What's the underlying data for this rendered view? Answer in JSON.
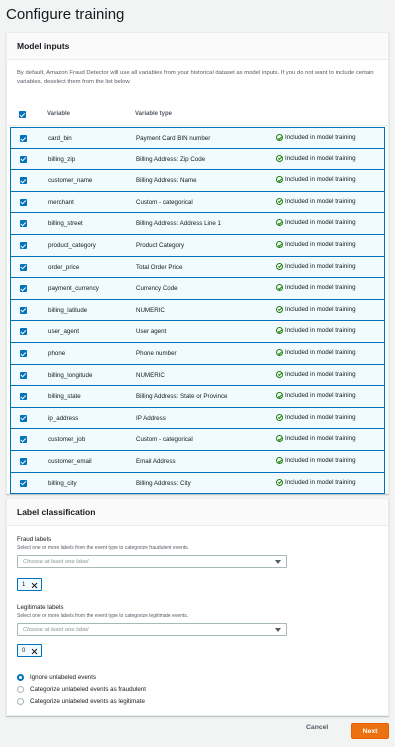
{
  "page": {
    "title": "Configure training"
  },
  "model_inputs": {
    "header": "Model inputs",
    "description": "By default, Amazon Fraud Detector will use all variables from your historical dataset as model inputs. If you do not want to include certain variables, deselect them from the list below.",
    "columns": [
      "Variable",
      "Variable type"
    ],
    "status_text": "Included in model training",
    "rows": [
      {
        "variable": "card_bin",
        "type": "Payment Card BIN number"
      },
      {
        "variable": "billing_zip",
        "type": "Billing Address: Zip Code"
      },
      {
        "variable": "customer_name",
        "type": "Billing Address: Name"
      },
      {
        "variable": "merchant",
        "type": "Custom - categorical"
      },
      {
        "variable": "billing_street",
        "type": "Billing Address: Address Line 1"
      },
      {
        "variable": "product_category",
        "type": "Product Category"
      },
      {
        "variable": "order_price",
        "type": "Total Order Price"
      },
      {
        "variable": "payment_currency",
        "type": "Currency Code"
      },
      {
        "variable": "billing_latitude",
        "type": "NUMERIC"
      },
      {
        "variable": "user_agent",
        "type": "User agent"
      },
      {
        "variable": "phone",
        "type": "Phone number"
      },
      {
        "variable": "billing_longitude",
        "type": "NUMERIC"
      },
      {
        "variable": "billing_state",
        "type": "Billing Address: State or Province"
      },
      {
        "variable": "ip_address",
        "type": "IP Address"
      },
      {
        "variable": "customer_job",
        "type": "Custom - categorical"
      },
      {
        "variable": "customer_email",
        "type": "Email Address"
      },
      {
        "variable": "billing_city",
        "type": "Billing Address: City"
      }
    ]
  },
  "label_classification": {
    "header": "Label classification",
    "fraud": {
      "label": "Fraud labels",
      "description": "Select one or more labels from the event type to categorize fraudulent events.",
      "placeholder": "Choose at least one label",
      "token": "1"
    },
    "legit": {
      "label": "Legitimate labels",
      "description": "Select one or more labels from the event type to categorize legitimate events.",
      "placeholder": "Choose at least one label",
      "token": "0"
    },
    "options": [
      {
        "label": "Ignore unlabeled events",
        "selected": true
      },
      {
        "label": "Categorize unlabeled events as fraudulent",
        "selected": false
      },
      {
        "label": "Categorize unlabeled events as legitimate",
        "selected": false
      }
    ]
  },
  "footer": {
    "cancel": "Cancel",
    "next": "Next"
  },
  "colors": {
    "accent": "#0073bb",
    "primary_button": "#ec7211",
    "success": "#1d8102"
  }
}
